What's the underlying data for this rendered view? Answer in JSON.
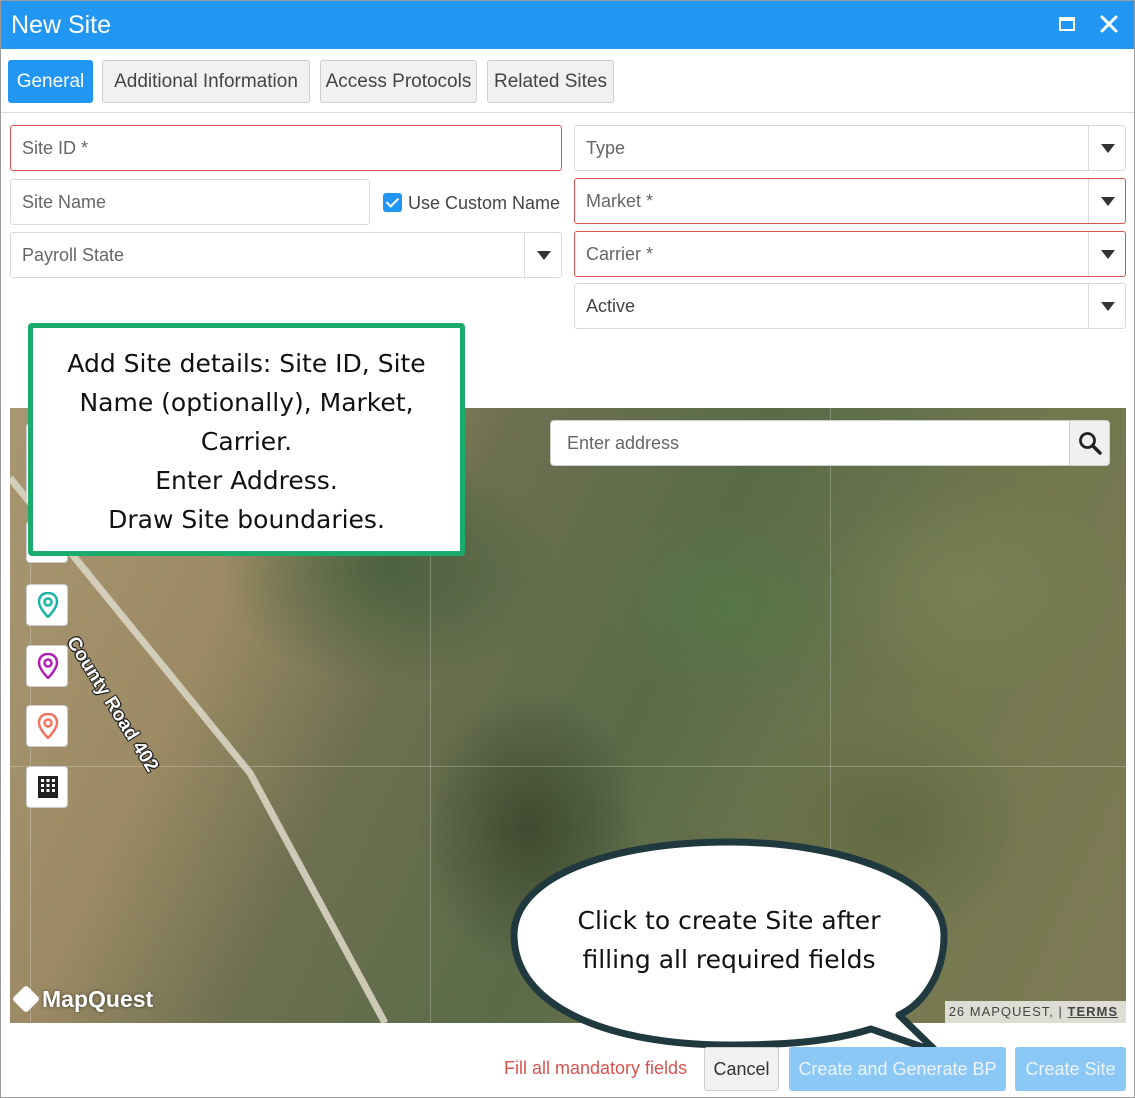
{
  "window": {
    "title": "New Site",
    "maximize_icon": "maximize-icon",
    "close_icon": "close-icon",
    "accent_color": "#2196f3"
  },
  "tabs": [
    {
      "label": "General",
      "active": true
    },
    {
      "label": "Additional Information",
      "active": false
    },
    {
      "label": "Access Protocols",
      "active": false
    },
    {
      "label": "Related Sites",
      "active": false
    }
  ],
  "form": {
    "site_id_placeholder": "Site ID *",
    "site_name_placeholder": "Site Name",
    "use_custom_name_label": "Use Custom Name",
    "use_custom_name_checked": true,
    "payroll_state_placeholder": "Payroll State",
    "type_placeholder": "Type",
    "market_placeholder": "Market *",
    "carrier_placeholder": "Carrier *",
    "status_value": "Active",
    "required_color": "#d9534f"
  },
  "map": {
    "search_placeholder": "Enter address",
    "search_icon": "search-icon",
    "road_label": "County Road 402",
    "logo_text": "MapQuest",
    "attribution_text": "26 MAPQUEST,  |",
    "terms_label": "TERMS",
    "tools": [
      "zoom-control",
      "compass-icon",
      "map-pin-teal-icon",
      "map-pin-purple-icon",
      "map-pin-orange-icon",
      "building-grid-icon"
    ]
  },
  "annotations": {
    "instructions_lines": [
      "Add Site details: Site ID, Site",
      "Name (optionally), Market,",
      "Carrier.",
      "Enter Address.",
      "Draw Site boundaries."
    ],
    "bubble_lines": [
      "Click to create Site after",
      "filling all required fields"
    ],
    "callout_border_color": "#1aab6d"
  },
  "footer": {
    "mandatory_note": "Fill all mandatory fields",
    "cancel_label": "Cancel",
    "create_generate_label": "Create and Generate BP",
    "create_site_label": "Create Site"
  }
}
